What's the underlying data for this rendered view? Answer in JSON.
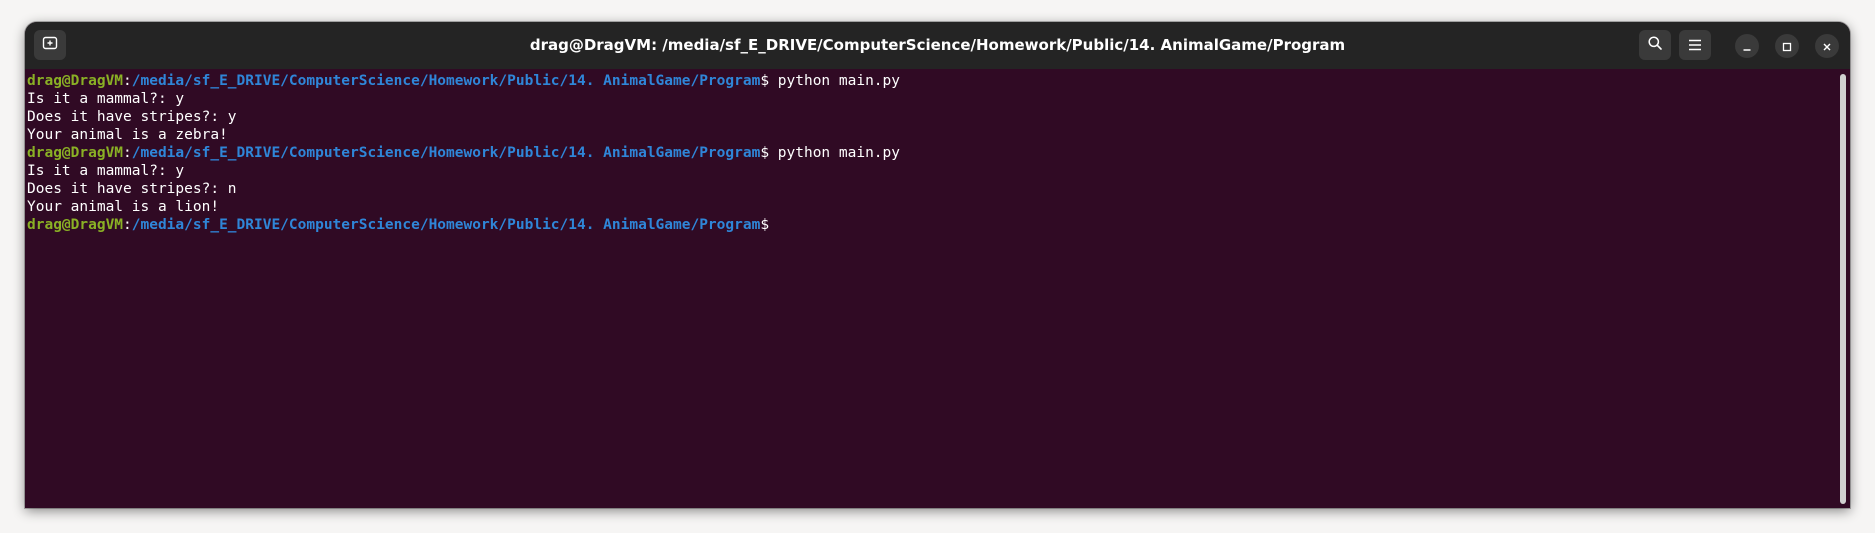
{
  "window": {
    "title": "drag@DragVM: /media/sf_E_DRIVE/ComputerScience/Homework/Public/14. AnimalGame/Program"
  },
  "titlebar": {
    "new_tab_icon": "new-tab-icon",
    "search_icon": "search-icon",
    "menu_icon": "hamburger-menu-icon",
    "minimize_icon": "minimize-icon",
    "maximize_icon": "maximize-icon",
    "close_icon": "close-icon"
  },
  "terminal": {
    "lines": [
      {
        "type": "prompt",
        "user": "drag@DragVM",
        "sep": ":",
        "path": "/media/sf_E_DRIVE/ComputerScience/Homework/Public/14. AnimalGame/Program",
        "dollar": "$ ",
        "cmd": "python main.py"
      },
      {
        "type": "output",
        "text": "Is it a mammal?: y"
      },
      {
        "type": "output",
        "text": "Does it have stripes?: y"
      },
      {
        "type": "output",
        "text": "Your animal is a zebra!"
      },
      {
        "type": "prompt",
        "user": "drag@DragVM",
        "sep": ":",
        "path": "/media/sf_E_DRIVE/ComputerScience/Homework/Public/14. AnimalGame/Program",
        "dollar": "$ ",
        "cmd": "python main.py"
      },
      {
        "type": "output",
        "text": "Is it a mammal?: y"
      },
      {
        "type": "output",
        "text": "Does it have stripes?: n"
      },
      {
        "type": "output",
        "text": "Your animal is a lion!"
      },
      {
        "type": "prompt",
        "user": "drag@DragVM",
        "sep": ":",
        "path": "/media/sf_E_DRIVE/ComputerScience/Homework/Public/14. AnimalGame/Program",
        "dollar": "$",
        "cmd": ""
      }
    ]
  },
  "colors": {
    "terminal_bg": "#300a24",
    "titlebar_bg": "#242424",
    "user_green": "#8ab025",
    "path_blue": "#2f86d8",
    "text": "#ffffff"
  }
}
